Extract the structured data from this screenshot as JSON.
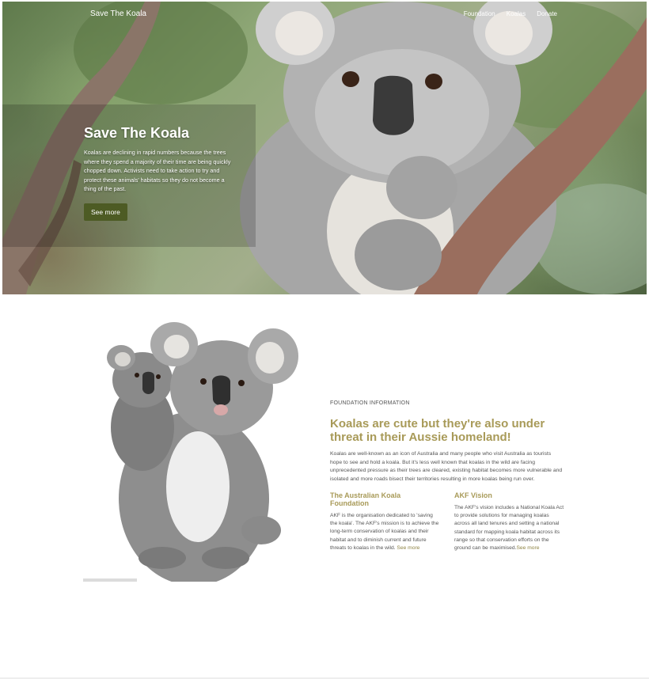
{
  "nav": {
    "brand": "Save The Koala",
    "links": [
      "Foundation",
      "Koalas",
      "Donate"
    ]
  },
  "hero": {
    "title": "Save The Koala",
    "text": "Koalas are declining in rapid numbers because the trees where they spend a majority of their time are being quickly chopped down. Activists need to take action to try and protect these animals' habitats so they do not become a thing of the past.",
    "button": "See more"
  },
  "info": {
    "eyebrow": "FOUNDATION INFORMATION",
    "title": "Koalas are cute but they're also under threat in their Aussie homeland!",
    "lead": "Koalas are well-known as an icon of Australia and many people who visit Australia as tourists hope to see and hold a koala. But it's less well known that koalas in the wild are facing unprecedented pressure as their trees are cleared, existing habitat becomes more vulnerable and isolated and more roads bisect their territories resulting in more koalas being run over.",
    "columns": [
      {
        "title": "The Australian Koala Foundation",
        "text": "AKF is the organisation dedicated to 'saving the koala'. The AKF's mission is to achieve the long-term conservation of koalas and their habitat and to diminish current and future threats to koalas in the wild.",
        "link": "See more"
      },
      {
        "title": "AKF Vision",
        "text": "The AKF's vision includes a National Koala Act to provide solutions for managing koalas across all land tenures and setting a national standard for mapping koala habitat across its range so that conservation efforts on the ground can be maximised.",
        "link": "See more"
      }
    ]
  },
  "colors": {
    "accent": "#a89a58",
    "button": "#4d5b24"
  }
}
